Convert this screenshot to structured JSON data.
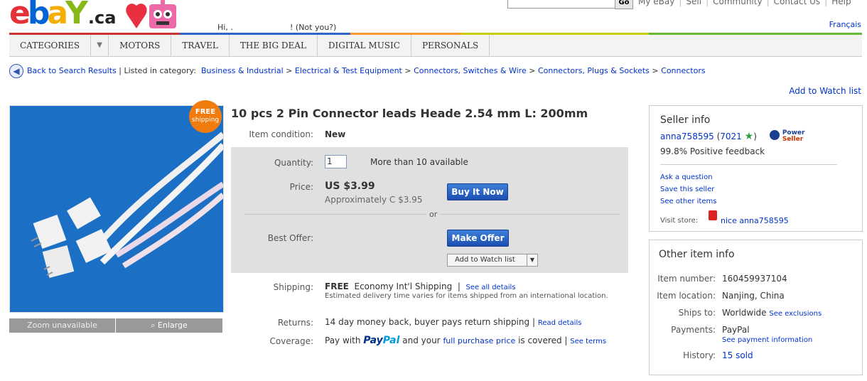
{
  "header": {
    "logo": {
      "e": "e",
      "b": "b",
      "a": "a",
      "y": "Y",
      "ca": ".ca"
    },
    "greeting": "Hi, .",
    "not_you": "! (Not you?)",
    "go_label": "Go",
    "top_links": [
      "My eBay",
      "Sell",
      "Community",
      "Contact Us",
      "Help"
    ],
    "language": "Français"
  },
  "nav": {
    "items": [
      "CATEGORIES",
      "MOTORS",
      "TRAVEL",
      "THE BIG DEAL",
      "DIGITAL MUSIC",
      "PERSONALS"
    ]
  },
  "breadcrumb": {
    "back": "Back to Search Results",
    "listed_label": "Listed in category:",
    "path": [
      "Business & Industrial",
      "Electrical & Test Equipment",
      "Connectors, Switches & Wire",
      "Connectors, Plugs & Sockets",
      "Connectors"
    ]
  },
  "add_to_watch_list_top": "Add to Watch list",
  "image": {
    "badge_line1": "FREE",
    "badge_line2": "shipping",
    "zoom": "Zoom unavailable",
    "enlarge": "Enlarge"
  },
  "item": {
    "title": "10 pcs 2 Pin Connector leads Heade 2.54 mm L: 200mm",
    "condition_label": "Item condition:",
    "condition": "New",
    "quantity_label": "Quantity:",
    "quantity_value": "1",
    "available": "More than 10 available",
    "price_label": "Price:",
    "price": "US $3.99",
    "approx": "Approximately C $3.95",
    "buy_now": "Buy It Now",
    "or": "or",
    "best_offer_label": "Best Offer:",
    "make_offer": "Make Offer",
    "watch_btn": "Add to Watch list",
    "shipping_label": "Shipping:",
    "shipping_free": "FREE",
    "shipping_method": "Economy Int'l Shipping",
    "shipping_details": "See all details",
    "shipping_note": "Estimated delivery time varies for items shipped from an international location.",
    "returns_label": "Returns:",
    "returns": "14 day money back, buyer pays return shipping |",
    "returns_link": "Read details",
    "coverage_label": "Coverage:",
    "coverage_pre": "Pay with",
    "paypal_pay": "Pay",
    "paypal_pal": "Pal",
    "coverage_mid": "and your",
    "coverage_link": "full purchase price",
    "coverage_post": "is covered |",
    "see_terms": "See terms"
  },
  "seller": {
    "heading": "Seller info",
    "name": "anna758595",
    "feedback_open": "(",
    "score": "7021",
    "feedback_close": ")",
    "power_line1": "Power",
    "power_line2": "Seller",
    "positive": "99.8% Positive feedback",
    "ask": "Ask a question",
    "save": "Save this seller",
    "other_items": "See other items",
    "visit_label": "Visit store:",
    "store": "nice anna758595"
  },
  "other_info": {
    "heading": "Other item info",
    "rows": [
      {
        "label": "Item number:",
        "value": "160459937104"
      },
      {
        "label": "Item location:",
        "value": "Nanjing, China"
      },
      {
        "label": "Ships to:",
        "value": "Worldwide"
      },
      {
        "label": "Payments:",
        "value": "PayPal"
      },
      {
        "label": "History:",
        "value": "15 sold"
      }
    ],
    "see_exclusions": "See exclusions",
    "see_payment": "See payment information"
  }
}
